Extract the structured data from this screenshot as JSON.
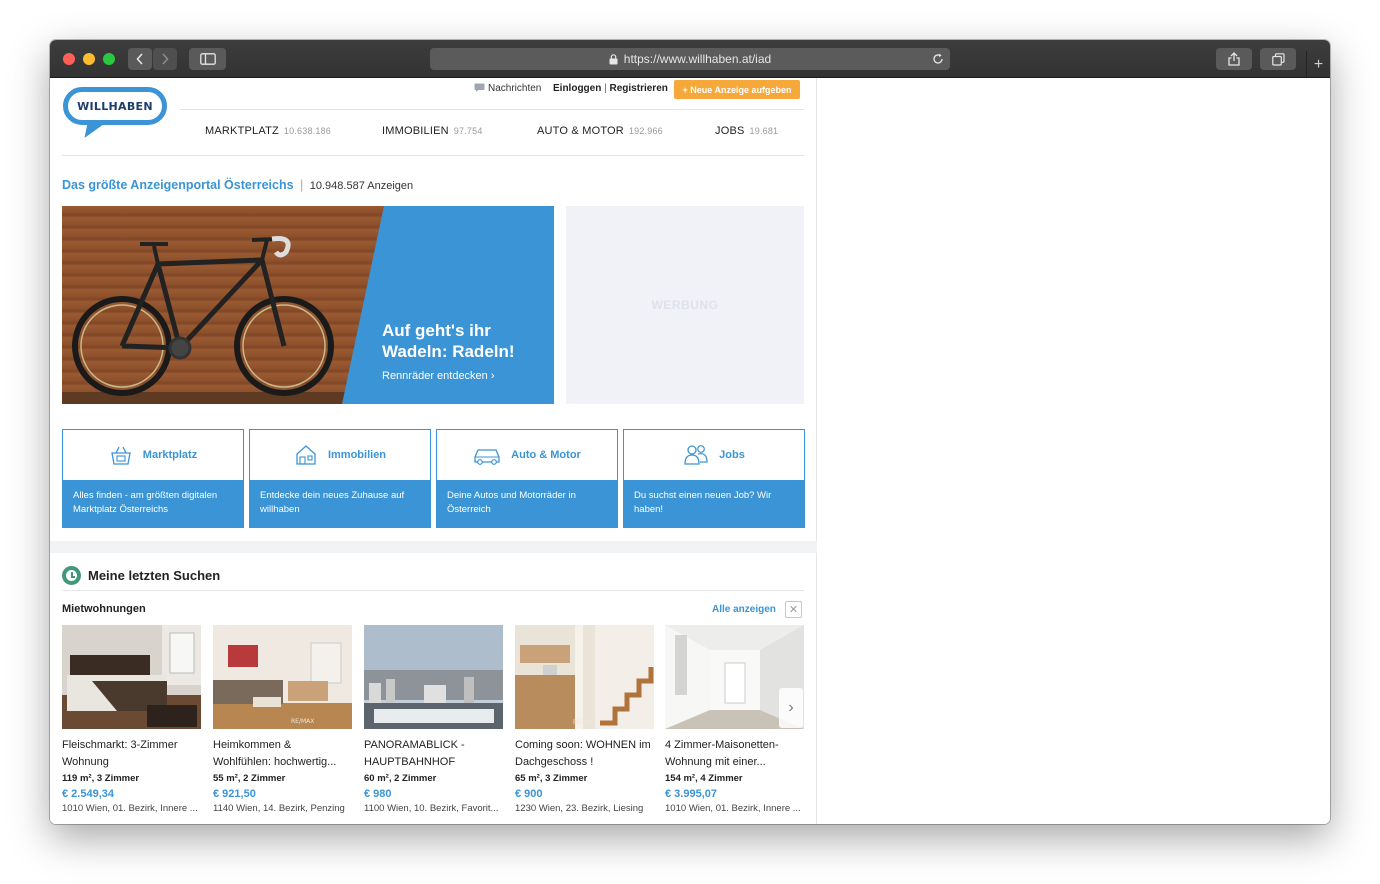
{
  "browser": {
    "url": "https://www.willhaben.at/iad",
    "plus": "+",
    "colors": {
      "close": "#fe5f57",
      "minimize": "#febc2e",
      "maximize": "#28c840"
    }
  },
  "header": {
    "logo_text": "WILLHABEN",
    "messages_label": "Nachrichten",
    "login_label": "Einloggen",
    "separator": "|",
    "register_label": "Registrieren",
    "new_ad_label": "+ Neue Anzeige aufgeben",
    "new_ad_color": "#f7a83b",
    "nav": [
      {
        "label": "MARKTPLATZ",
        "count": "10.638.186"
      },
      {
        "label": "IMMOBILIEN",
        "count": "97.754"
      },
      {
        "label": "AUTO & MOTOR",
        "count": "192.966"
      },
      {
        "label": "JOBS",
        "count": "19.681"
      }
    ]
  },
  "tagline": {
    "text": "Das größte Anzeigenportal Österreichs",
    "separator": "|",
    "count": "10.948.587 Anzeigen"
  },
  "hero": {
    "title": "Auf geht's ihr Wadeln: Radeln!",
    "link": "Rennräder entdecken ›"
  },
  "ad": {
    "label": "WERBUNG"
  },
  "categories": [
    {
      "title": "Marktplatz",
      "icon": "basket-icon",
      "desc": "Alles finden - am größten digitalen Marktplatz Österreichs"
    },
    {
      "title": "Immobilien",
      "icon": "house-icon",
      "desc": "Entdecke dein neues Zuhause auf willhaben"
    },
    {
      "title": "Auto & Motor",
      "icon": "car-icon",
      "desc": "Deine Autos und Motorräder in Österreich"
    },
    {
      "title": "Jobs",
      "icon": "people-icon",
      "desc": "Du suchst einen neuen Job? Wir haben!"
    }
  ],
  "recent": {
    "title": "Meine letzten Suchen",
    "subtitle": "Mietwohnungen",
    "all_label": "Alle anzeigen",
    "close_label": "✕",
    "next_label": "›",
    "listings": [
      {
        "title": "Fleischmarkt: 3-Zimmer Wohnung",
        "meta": "119 m², 3 Zimmer",
        "price": "€ 2.549,34",
        "location": "1010 Wien, 01. Bezirk, Innere ..."
      },
      {
        "title": "Heimkommen & Wohlfühlen: hochwertig...",
        "meta": "55 m², 2 Zimmer",
        "price": "€ 921,50",
        "location": "1140 Wien, 14. Bezirk, Penzing"
      },
      {
        "title": "PANORAMABLICK - HAUPTBAHNHOF",
        "meta": "60 m², 2 Zimmer",
        "price": "€ 980",
        "location": "1100 Wien, 10. Bezirk, Favorit..."
      },
      {
        "title": "Coming soon: WOHNEN im Dachgeschoss !",
        "meta": "65 m², 3 Zimmer",
        "price": "€ 900",
        "location": "1230 Wien, 23. Bezirk, Liesing"
      },
      {
        "title": "4 Zimmer-Maisonetten-Wohnung mit einer...",
        "meta": "154 m², 4 Zimmer",
        "price": "€ 3.995,07",
        "location": "1010 Wien, 01. Bezirk, Innere ..."
      }
    ]
  }
}
